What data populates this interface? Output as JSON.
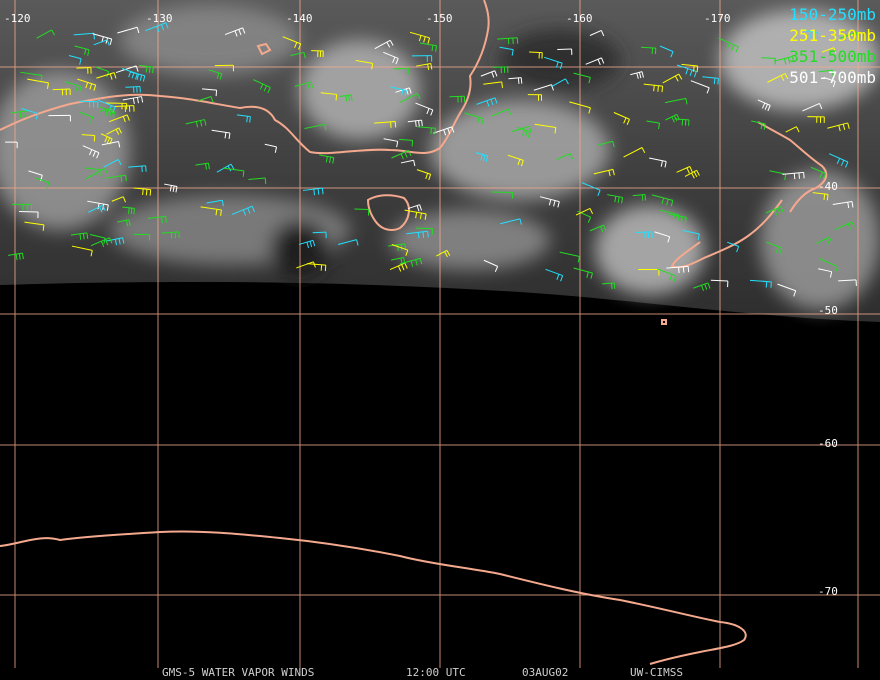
{
  "colors": {
    "coast": "#f4a98e",
    "grid": "#f4a98e",
    "level_150_250": "#22e0ff",
    "level_251_350": "#ffff00",
    "level_351_500": "#22dd22",
    "level_501_700": "#ffffff"
  },
  "longitude_labels": [
    "-120",
    "-130",
    "-140",
    "-150",
    "-160",
    "-170"
  ],
  "latitude_labels": [
    "-40",
    "-50",
    "-60",
    "-70"
  ],
  "legend": [
    {
      "label": "150-250mb",
      "color": "#22e0ff"
    },
    {
      "label": "251-350mb",
      "color": "#ffff00"
    },
    {
      "label": "351-500mb",
      "color": "#22dd22"
    },
    {
      "label": "501-700mb",
      "color": "#ffffff"
    }
  ],
  "footer": {
    "satellite": "GMS-5 WATER VAPOR WINDS",
    "time": "12:00 UTC",
    "date": "03AUG02",
    "source": "UW-CIMSS"
  }
}
